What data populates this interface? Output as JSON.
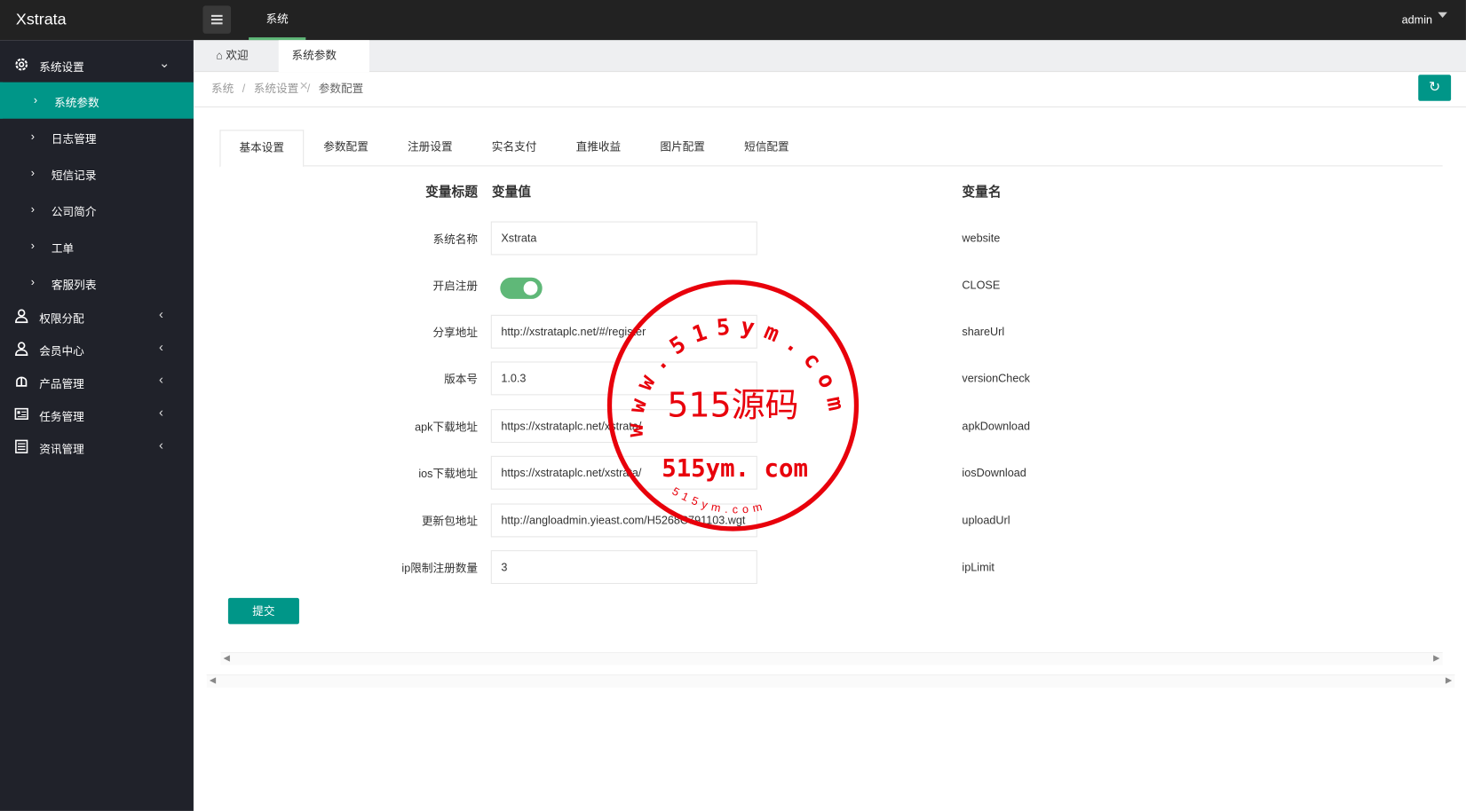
{
  "app": {
    "title": "Xstrata",
    "user": "admin"
  },
  "topnav": {
    "active": "系统"
  },
  "sidebar": {
    "groups": [
      {
        "label": "系统设置",
        "icon": "gear-icon",
        "expanded": true,
        "items": [
          {
            "label": "系统参数",
            "active": true
          },
          {
            "label": "日志管理"
          },
          {
            "label": "短信记录"
          },
          {
            "label": "公司简介"
          },
          {
            "label": "工单"
          },
          {
            "label": "客服列表"
          }
        ]
      },
      {
        "label": "权限分配",
        "icon": "user-group-icon"
      },
      {
        "label": "会员中心",
        "icon": "user-icon"
      },
      {
        "label": "产品管理",
        "icon": "product-icon"
      },
      {
        "label": "任务管理",
        "icon": "task-icon"
      },
      {
        "label": "资讯管理",
        "icon": "news-icon"
      }
    ]
  },
  "page_tabs": [
    {
      "label": "欢迎",
      "icon": "home-icon"
    },
    {
      "label": "系统参数",
      "closable": true,
      "active": true
    }
  ],
  "breadcrumb": [
    "系统",
    "系统设置",
    "参数配置"
  ],
  "content_tabs": [
    "基本设置",
    "参数配置",
    "注册设置",
    "实名支付",
    "直推收益",
    "图片配置",
    "短信配置"
  ],
  "form": {
    "headers": {
      "title": "变量标题",
      "value": "变量值",
      "name": "变量名"
    },
    "rows": [
      {
        "label": "系统名称",
        "value": "Xstrata",
        "name": "website"
      },
      {
        "label": "开启注册",
        "type": "toggle",
        "on": true,
        "name": "CLOSE"
      },
      {
        "label": "分享地址",
        "value": "http://xstrataplc.net/#/register",
        "name": "shareUrl"
      },
      {
        "label": "版本号",
        "value": "1.0.3",
        "name": "versionCheck"
      },
      {
        "label": "apk下载地址",
        "value": "https://xstrataplc.net/xstrata/",
        "name": "apkDownload"
      },
      {
        "label": "ios下载地址",
        "value": "https://xstrataplc.net/xstrata/",
        "name": "iosDownload"
      },
      {
        "label": "更新包地址",
        "value": "http://angloadmin.yieast.com/H5268C791103.wgt",
        "name": "uploadUrl"
      },
      {
        "label": "ip限制注册数量",
        "value": "3",
        "name": "ipLimit"
      }
    ],
    "submit": "提交"
  },
  "watermark": {
    "center": "515源码",
    "url": "515ym. com",
    "ring": "www.515ym.com",
    "small": "515ym.com",
    "color": "#e8000b"
  },
  "colors": {
    "accent": "#009688",
    "toggle": "#5fb878",
    "sidebar": "#20222a",
    "topbar": "#222222"
  }
}
